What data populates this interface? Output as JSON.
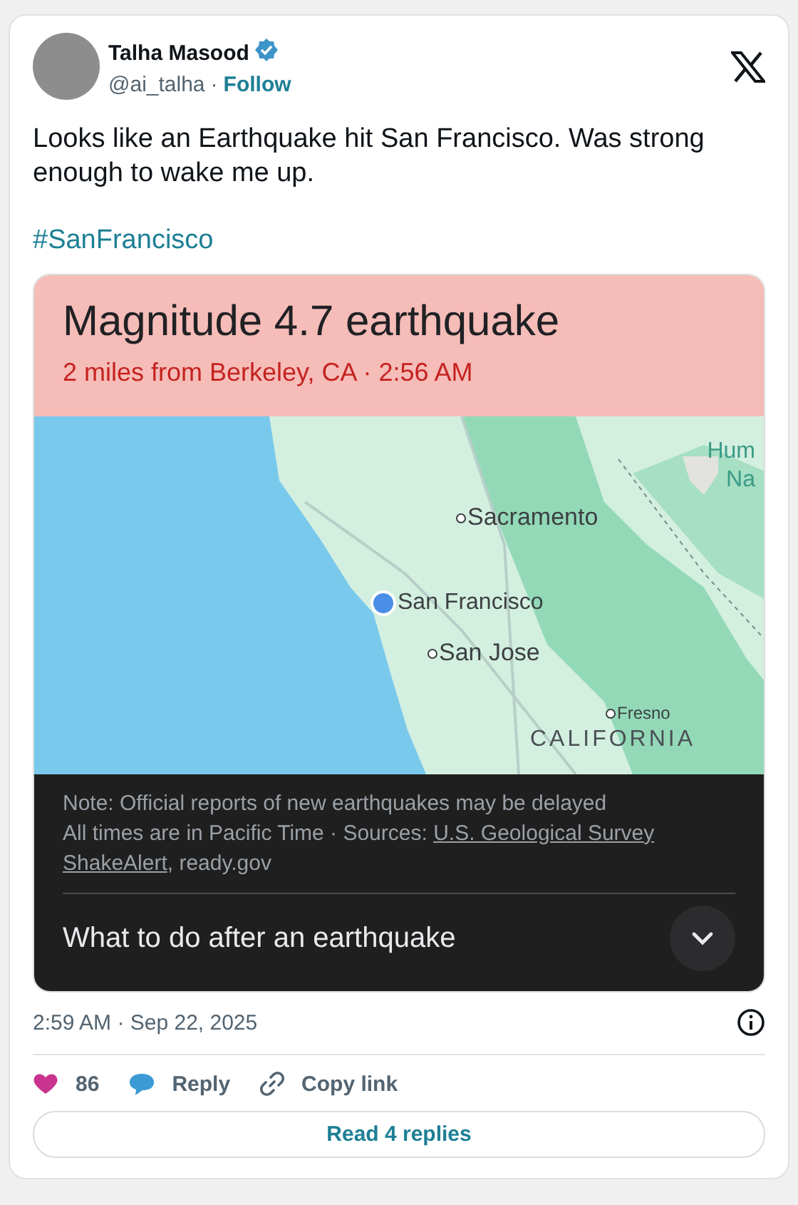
{
  "author": {
    "name": "Talha Masood",
    "verified": true,
    "handle": "@ai_talha",
    "separator": "·",
    "follow": "Follow"
  },
  "text": "Looks like an Earthquake hit San Francisco. Was strong enough to wake me up.",
  "hashtag": "#SanFrancisco",
  "alert": {
    "title": "Magnitude 4.7 earthquake",
    "subtitle": "2 miles from Berkeley, CA · 2:56 AM",
    "map_labels": [
      {
        "text": "Hum Na",
        "kind": "park"
      },
      {
        "text": "Sacramento",
        "kind": "city"
      },
      {
        "text": "San Francisco",
        "kind": "marked"
      },
      {
        "text": "San Jose",
        "kind": "city"
      },
      {
        "text": "Fresno",
        "kind": "town"
      },
      {
        "text": "CALIFORNIA",
        "kind": "region"
      }
    ],
    "note": "Note: Official reports of new earthquakes may be delayed",
    "sources": "All times are in Pacific Time · Sources: ",
    "links": [
      "U.S. Geological Survey",
      "ShakeAlert"
    ],
    "sources_end": ", ready.gov",
    "action": "What to do after an earthquake"
  },
  "timestamp": "2:59 AM · Sep 22, 2025",
  "actions": [
    {
      "kind": "like",
      "label": "86"
    },
    {
      "kind": "reply",
      "label": "Reply"
    },
    {
      "kind": "copy",
      "label": "Copy link"
    }
  ],
  "read_replies": "Read 4 replies"
}
